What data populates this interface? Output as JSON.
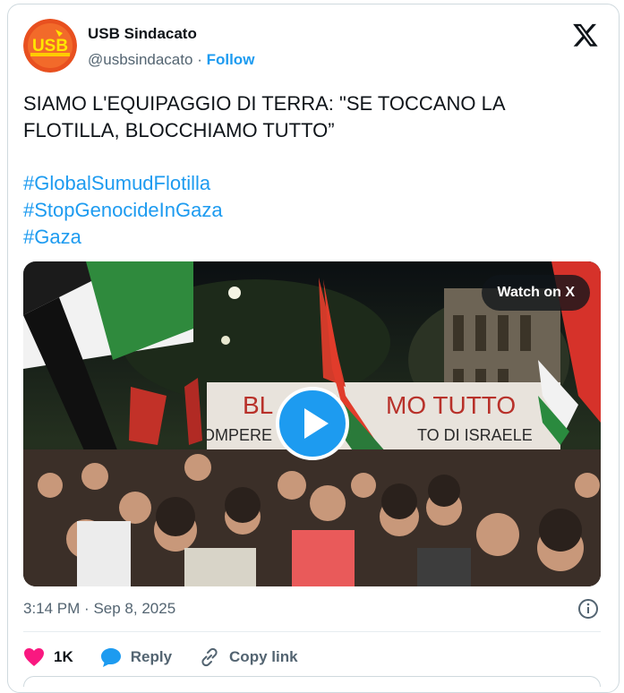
{
  "author": {
    "name": "USB Sindacato",
    "handle": "@usbsindacato",
    "separator": "·",
    "follow_label": "Follow",
    "avatar_text": "USB",
    "avatar_color": "#e8501f"
  },
  "tweet": {
    "text_line1": "SIAMO L'EQUIPAGGIO DI TERRA: \"SE TOCCANO LA",
    "text_line2": "FLOTILLA, BLOCCHIAMO TUTTO”",
    "hashtags": [
      "#GlobalSumudFlotilla",
      "#StopGenocideInGaza",
      "#Gaza"
    ]
  },
  "media": {
    "watch_label": "Watch on X",
    "banner_text1": "BL",
    "banner_text2": "MO TUTTO",
    "banner_sub1": "OMPERE",
    "banner_sub2": "TO  DI ISRAELE"
  },
  "meta": {
    "time": "3:14 PM",
    "separator": "·",
    "date": "Sep 8, 2025"
  },
  "actions": {
    "likes": "1K",
    "reply_label": "Reply",
    "copy_label": "Copy link"
  },
  "colors": {
    "accent": "#1d9bf0",
    "like": "#f91880",
    "muted": "#536471"
  }
}
